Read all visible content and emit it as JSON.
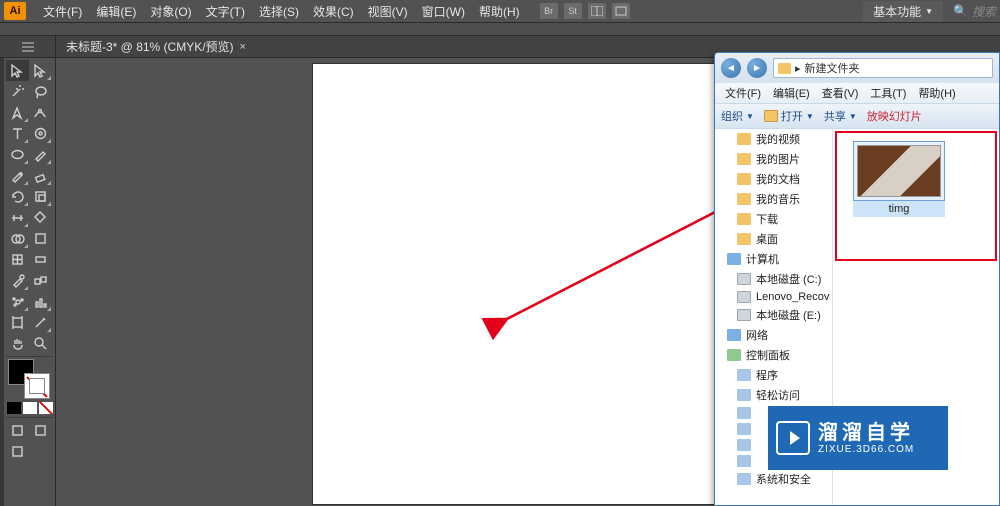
{
  "menubar": {
    "items": [
      "文件(F)",
      "编辑(E)",
      "对象(O)",
      "文字(T)",
      "选择(S)",
      "效果(C)",
      "视图(V)",
      "窗口(W)",
      "帮助(H)"
    ],
    "small_badges": [
      "Br",
      "St"
    ],
    "workspace_label": "基本功能",
    "search_placeholder": "搜索"
  },
  "doc_tab": {
    "title": "未标题-3* @ 81% (CMYK/预览)"
  },
  "tools": [
    {
      "name": "selection-tool",
      "tri": 0
    },
    {
      "name": "direct-selection-tool",
      "tri": 1
    },
    {
      "name": "magic-wand-tool",
      "tri": 0
    },
    {
      "name": "lasso-tool",
      "tri": 0
    },
    {
      "name": "pen-tool",
      "tri": 1
    },
    {
      "name": "curvature-tool",
      "tri": 0
    },
    {
      "name": "type-tool",
      "tri": 1
    },
    {
      "name": "line-segment-tool",
      "tri": 1
    },
    {
      "name": "ellipse-tool",
      "tri": 1
    },
    {
      "name": "paintbrush-tool",
      "tri": 1
    },
    {
      "name": "shaper-tool",
      "tri": 1
    },
    {
      "name": "eraser-tool",
      "tri": 1
    },
    {
      "name": "rotate-tool",
      "tri": 1
    },
    {
      "name": "scale-tool",
      "tri": 1
    },
    {
      "name": "width-tool",
      "tri": 1
    },
    {
      "name": "free-transform-tool",
      "tri": 0
    },
    {
      "name": "shape-builder-tool",
      "tri": 1
    },
    {
      "name": "perspective-grid-tool",
      "tri": 0
    },
    {
      "name": "mesh-tool",
      "tri": 0
    },
    {
      "name": "gradient-tool",
      "tri": 0
    },
    {
      "name": "eyedropper-tool",
      "tri": 1
    },
    {
      "name": "blend-tool",
      "tri": 0
    },
    {
      "name": "symbol-sprayer-tool",
      "tri": 1
    },
    {
      "name": "column-graph-tool",
      "tri": 1
    },
    {
      "name": "artboard-tool",
      "tri": 0
    },
    {
      "name": "slice-tool",
      "tri": 1
    },
    {
      "name": "hand-tool",
      "tri": 0
    },
    {
      "name": "zoom-tool",
      "tri": 0
    }
  ],
  "explorer": {
    "path_segments": [
      "新建文件夹"
    ],
    "menus": [
      "文件(F)",
      "编辑(E)",
      "查看(V)",
      "工具(T)",
      "帮助(H)"
    ],
    "toolbar": {
      "organize": "组织",
      "open": "打开",
      "share": "共享",
      "slideshow": "放映幻灯片"
    },
    "tree": [
      {
        "label": "我的视频",
        "type": "folder",
        "lvl": 2
      },
      {
        "label": "我的图片",
        "type": "folder",
        "lvl": 2
      },
      {
        "label": "我的文档",
        "type": "folder",
        "lvl": 2
      },
      {
        "label": "我的音乐",
        "type": "folder",
        "lvl": 2
      },
      {
        "label": "下载",
        "type": "folder",
        "lvl": 2
      },
      {
        "label": "桌面",
        "type": "folder",
        "lvl": 2
      },
      {
        "label": "计算机",
        "type": "net",
        "lvl": 1
      },
      {
        "label": "本地磁盘 (C:)",
        "type": "drive",
        "lvl": 2
      },
      {
        "label": "Lenovo_Recov",
        "type": "drive",
        "lvl": 2
      },
      {
        "label": "本地磁盘 (E:)",
        "type": "drive",
        "lvl": 2
      },
      {
        "label": "网络",
        "type": "net",
        "lvl": 1
      },
      {
        "label": "控制面板",
        "type": "panel",
        "lvl": 1
      },
      {
        "label": "程序",
        "type": "gear",
        "lvl": 2
      },
      {
        "label": "轻松访问",
        "type": "gear",
        "lvl": 2
      },
      {
        "label": "",
        "type": "gear",
        "lvl": 2
      },
      {
        "label": "",
        "type": "gear",
        "lvl": 2
      },
      {
        "label": "",
        "type": "gear",
        "lvl": 2
      },
      {
        "label": "",
        "type": "gear",
        "lvl": 2
      },
      {
        "label": "系统和安全",
        "type": "gear",
        "lvl": 2
      }
    ],
    "file": {
      "name": "timg"
    }
  },
  "watermark": {
    "line1": "溜溜自学",
    "line2": "ZIXUE.3D66.COM"
  }
}
